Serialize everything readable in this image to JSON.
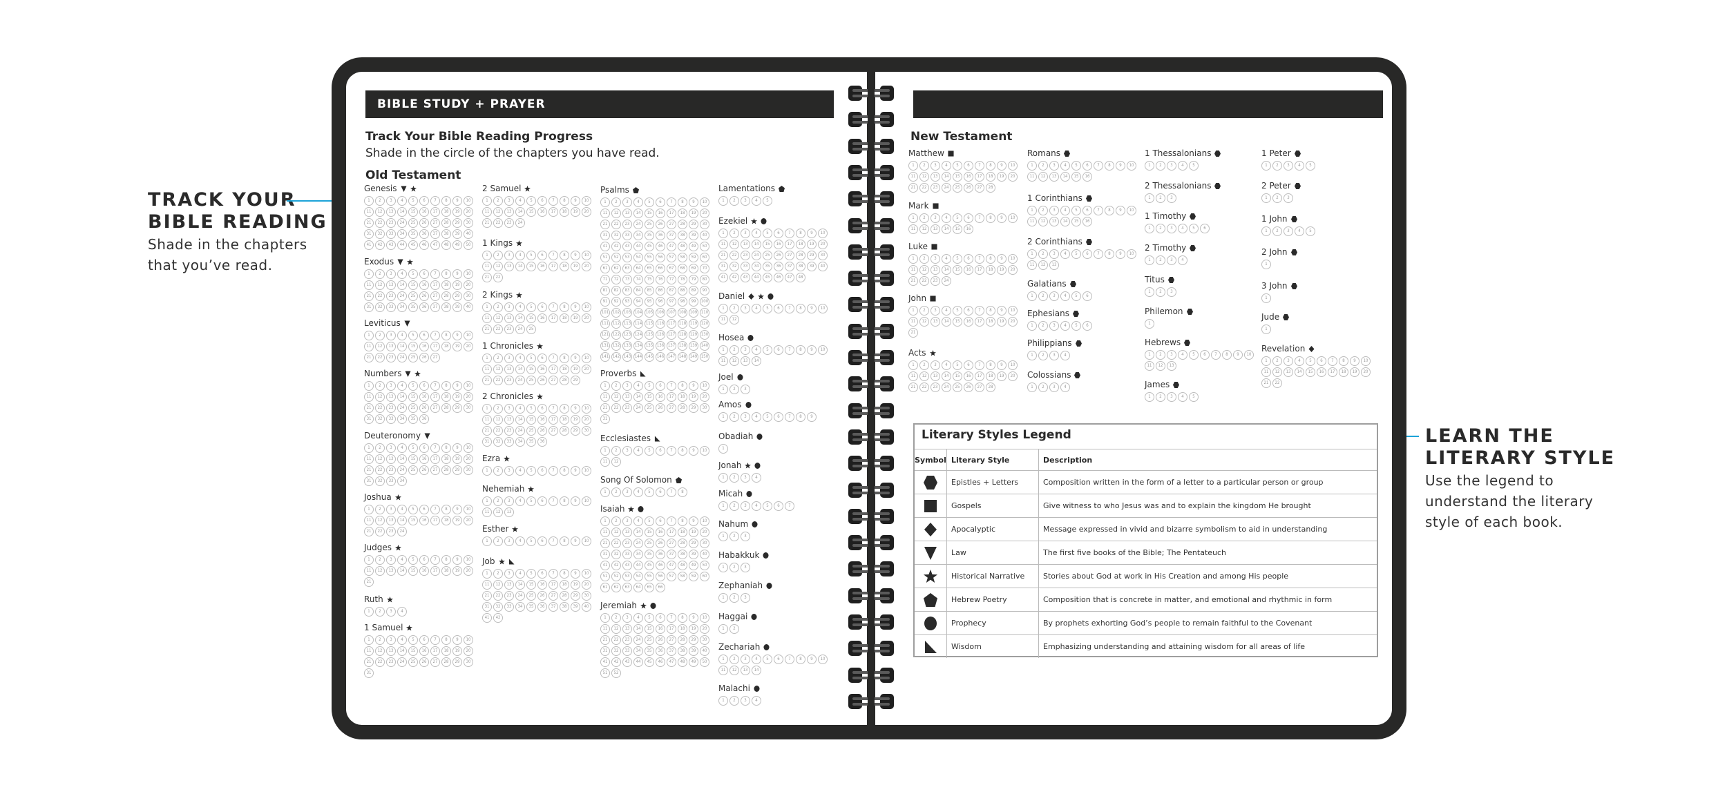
{
  "left_page": {
    "header": "BIBLE STUDY + PRAYER",
    "title": "Track Your Bible Reading Progress",
    "subtitle": "Shade in the circle of the chapters you have read.",
    "section": "Old Testament"
  },
  "right_page": {
    "header": "",
    "section": "New Testament"
  },
  "old_testament": [
    {
      "name": "Genesis",
      "chapters": 50,
      "symbols": [
        "law",
        "historical"
      ]
    },
    {
      "name": "Exodus",
      "chapters": 40,
      "symbols": [
        "law",
        "historical"
      ]
    },
    {
      "name": "Leviticus",
      "chapters": 27,
      "symbols": [
        "law"
      ]
    },
    {
      "name": "Numbers",
      "chapters": 36,
      "symbols": [
        "law",
        "historical"
      ]
    },
    {
      "name": "Deuteronomy",
      "chapters": 34,
      "symbols": [
        "law"
      ]
    },
    {
      "name": "Joshua",
      "chapters": 24,
      "symbols": [
        "historical"
      ]
    },
    {
      "name": "Judges",
      "chapters": 21,
      "symbols": [
        "historical"
      ]
    },
    {
      "name": "Ruth",
      "chapters": 4,
      "symbols": [
        "historical"
      ]
    },
    {
      "name": "1 Samuel",
      "chapters": 31,
      "symbols": [
        "historical"
      ]
    },
    {
      "name": "2 Samuel",
      "chapters": 24,
      "symbols": [
        "historical"
      ]
    },
    {
      "name": "1 Kings",
      "chapters": 22,
      "symbols": [
        "historical"
      ]
    },
    {
      "name": "2 Kings",
      "chapters": 25,
      "symbols": [
        "historical"
      ]
    },
    {
      "name": "1 Chronicles",
      "chapters": 29,
      "symbols": [
        "historical"
      ]
    },
    {
      "name": "2 Chronicles",
      "chapters": 36,
      "symbols": [
        "historical"
      ]
    },
    {
      "name": "Ezra",
      "chapters": 10,
      "symbols": [
        "historical"
      ]
    },
    {
      "name": "Nehemiah",
      "chapters": 13,
      "symbols": [
        "historical"
      ]
    },
    {
      "name": "Esther",
      "chapters": 10,
      "symbols": [
        "historical"
      ]
    },
    {
      "name": "Job",
      "chapters": 42,
      "symbols": [
        "historical",
        "wisdom"
      ]
    },
    {
      "name": "Psalms",
      "chapters": 150,
      "symbols": [
        "poetry"
      ]
    },
    {
      "name": "Proverbs",
      "chapters": 31,
      "symbols": [
        "wisdom"
      ]
    },
    {
      "name": "Ecclesiastes",
      "chapters": 12,
      "symbols": [
        "wisdom"
      ]
    },
    {
      "name": "Song Of Solomon",
      "chapters": 8,
      "symbols": [
        "poetry"
      ]
    },
    {
      "name": "Isaiah",
      "chapters": 66,
      "symbols": [
        "historical",
        "prophecy"
      ]
    },
    {
      "name": "Jeremiah",
      "chapters": 52,
      "symbols": [
        "historical",
        "prophecy"
      ]
    },
    {
      "name": "Lamentations",
      "chapters": 5,
      "symbols": [
        "poetry"
      ]
    },
    {
      "name": "Ezekiel",
      "chapters": 48,
      "symbols": [
        "historical",
        "prophecy"
      ]
    },
    {
      "name": "Daniel",
      "chapters": 12,
      "symbols": [
        "apocalyptic",
        "historical",
        "prophecy"
      ]
    },
    {
      "name": "Hosea",
      "chapters": 14,
      "symbols": [
        "prophecy"
      ]
    },
    {
      "name": "Joel",
      "chapters": 3,
      "symbols": [
        "prophecy"
      ]
    },
    {
      "name": "Amos",
      "chapters": 9,
      "symbols": [
        "prophecy"
      ]
    },
    {
      "name": "Obadiah",
      "chapters": 1,
      "symbols": [
        "prophecy"
      ]
    },
    {
      "name": "Jonah",
      "chapters": 4,
      "symbols": [
        "historical",
        "prophecy"
      ]
    },
    {
      "name": "Micah",
      "chapters": 7,
      "symbols": [
        "prophecy"
      ]
    },
    {
      "name": "Nahum",
      "chapters": 3,
      "symbols": [
        "prophecy"
      ]
    },
    {
      "name": "Habakkuk",
      "chapters": 3,
      "symbols": [
        "prophecy"
      ]
    },
    {
      "name": "Zephaniah",
      "chapters": 3,
      "symbols": [
        "prophecy"
      ]
    },
    {
      "name": "Haggai",
      "chapters": 2,
      "symbols": [
        "prophecy"
      ]
    },
    {
      "name": "Zechariah",
      "chapters": 14,
      "symbols": [
        "prophecy"
      ]
    },
    {
      "name": "Malachi",
      "chapters": 4,
      "symbols": [
        "prophecy"
      ]
    }
  ],
  "new_testament": [
    {
      "name": "Matthew",
      "chapters": 28,
      "symbols": [
        "gospels"
      ]
    },
    {
      "name": "Mark",
      "chapters": 16,
      "symbols": [
        "gospels"
      ]
    },
    {
      "name": "Luke",
      "chapters": 24,
      "symbols": [
        "gospels"
      ]
    },
    {
      "name": "John",
      "chapters": 21,
      "symbols": [
        "gospels"
      ]
    },
    {
      "name": "Acts",
      "chapters": 28,
      "symbols": [
        "historical"
      ]
    },
    {
      "name": "Romans",
      "chapters": 16,
      "symbols": [
        "epistles"
      ]
    },
    {
      "name": "1 Corinthians",
      "chapters": 16,
      "symbols": [
        "epistles"
      ]
    },
    {
      "name": "2 Corinthians",
      "chapters": 13,
      "symbols": [
        "epistles"
      ]
    },
    {
      "name": "Galatians",
      "chapters": 6,
      "symbols": [
        "epistles"
      ]
    },
    {
      "name": "Ephesians",
      "chapters": 6,
      "symbols": [
        "epistles"
      ]
    },
    {
      "name": "Philippians",
      "chapters": 4,
      "symbols": [
        "epistles"
      ]
    },
    {
      "name": "Colossians",
      "chapters": 4,
      "symbols": [
        "epistles"
      ]
    },
    {
      "name": "1 Thessalonians",
      "chapters": 5,
      "symbols": [
        "epistles"
      ]
    },
    {
      "name": "2 Thessalonians",
      "chapters": 3,
      "symbols": [
        "epistles"
      ]
    },
    {
      "name": "1 Timothy",
      "chapters": 6,
      "symbols": [
        "epistles"
      ]
    },
    {
      "name": "2 Timothy",
      "chapters": 4,
      "symbols": [
        "epistles"
      ]
    },
    {
      "name": "Titus",
      "chapters": 3,
      "symbols": [
        "epistles"
      ]
    },
    {
      "name": "Philemon",
      "chapters": 1,
      "symbols": [
        "epistles"
      ]
    },
    {
      "name": "Hebrews",
      "chapters": 13,
      "symbols": [
        "epistles"
      ]
    },
    {
      "name": "James",
      "chapters": 5,
      "symbols": [
        "epistles"
      ]
    },
    {
      "name": "1 Peter",
      "chapters": 5,
      "symbols": [
        "epistles"
      ]
    },
    {
      "name": "2 Peter",
      "chapters": 3,
      "symbols": [
        "epistles"
      ]
    },
    {
      "name": "1 John",
      "chapters": 5,
      "symbols": [
        "epistles"
      ]
    },
    {
      "name": "2 John",
      "chapters": 1,
      "symbols": [
        "epistles"
      ]
    },
    {
      "name": "3 John",
      "chapters": 1,
      "symbols": [
        "epistles"
      ]
    },
    {
      "name": "Jude",
      "chapters": 1,
      "symbols": [
        "epistles"
      ]
    },
    {
      "name": "Revelation",
      "chapters": 22,
      "symbols": [
        "apocalyptic"
      ]
    }
  ],
  "legend": {
    "title": "Literary Styles Legend",
    "headers": {
      "symbol": "Symbol",
      "style": "Literary Style",
      "description": "Description"
    },
    "rows": [
      {
        "key": "epistles",
        "icon": "hexagon-icon",
        "style": "Epistles + Letters",
        "description": "Composition written in the form of a letter to a particular person or group"
      },
      {
        "key": "gospels",
        "icon": "square-icon",
        "style": "Gospels",
        "description": "Give witness to who Jesus was and to explain the kingdom He brought"
      },
      {
        "key": "apocalyptic",
        "icon": "diamond-icon",
        "style": "Apocalyptic",
        "description": "Message expressed in vivid and bizarre symbolism to aid in understanding"
      },
      {
        "key": "law",
        "icon": "triangle-down-icon",
        "style": "Law",
        "description": "The first five books of the Bible; The Pentateuch"
      },
      {
        "key": "historical",
        "icon": "star-icon",
        "style": "Historical Narrative",
        "description": "Stories about God at work in His Creation and among His people"
      },
      {
        "key": "poetry",
        "icon": "pentagon-icon",
        "style": "Hebrew Poetry",
        "description": "Composition that is concrete in matter, and emotional and rhythmic in form"
      },
      {
        "key": "prophecy",
        "icon": "circle-icon",
        "style": "Prophecy",
        "description": "By prophets exhorting God’s people to remain faithful to the Covenant"
      },
      {
        "key": "wisdom",
        "icon": "wisdom-triangle-icon",
        "style": "Wisdom",
        "description": "Emphasizing understanding and attaining wisdom for all areas of life"
      }
    ]
  },
  "callouts": {
    "left": {
      "title_line1": "TRACK YOUR",
      "title_line2": "BIBLE READING",
      "text_line1": "Shade in the chapters",
      "text_line2": "that you’ve read."
    },
    "right": {
      "title_line1": "LEARN THE",
      "title_line2": "LITERARY STYLE",
      "text_line1": "Use the legend to",
      "text_line2": "understand the literary",
      "text_line3": "style of each book."
    }
  },
  "colors": {
    "frame": "#282827",
    "accent": "#1ba3d8",
    "circle": "#bdbdbd"
  }
}
